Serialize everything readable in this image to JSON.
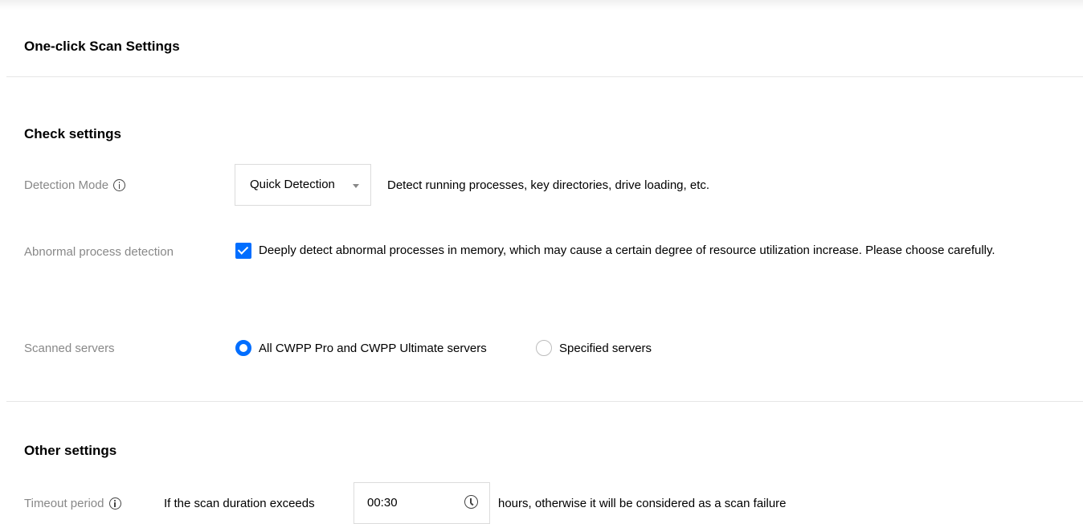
{
  "header": {
    "title": "One-click Scan Settings"
  },
  "check_settings": {
    "title": "Check settings",
    "detection_mode": {
      "label": "Detection Mode",
      "icon": "info-icon",
      "selected": "Quick Detection",
      "description": "Detect running processes, key directories, drive loading, etc."
    },
    "abnormal_process": {
      "label": "Abnormal process detection",
      "checked": true,
      "text": "Deeply detect abnormal processes in memory, which may cause a certain degree of resource utilization increase. Please choose carefully."
    },
    "scanned_servers": {
      "label": "Scanned servers",
      "options": [
        {
          "label": "All CWPP Pro and CWPP Ultimate servers",
          "selected": true
        },
        {
          "label": "Specified servers",
          "selected": false
        }
      ]
    }
  },
  "other_settings": {
    "title": "Other settings",
    "timeout": {
      "label": "Timeout period",
      "icon": "info-icon",
      "prefix": "If the scan duration exceeds",
      "value": "00:30",
      "suffix": "hours, otherwise it will be considered as a scan failure"
    }
  },
  "colors": {
    "accent": "#006eff",
    "label": "#888888",
    "border": "#dcdcdc"
  }
}
